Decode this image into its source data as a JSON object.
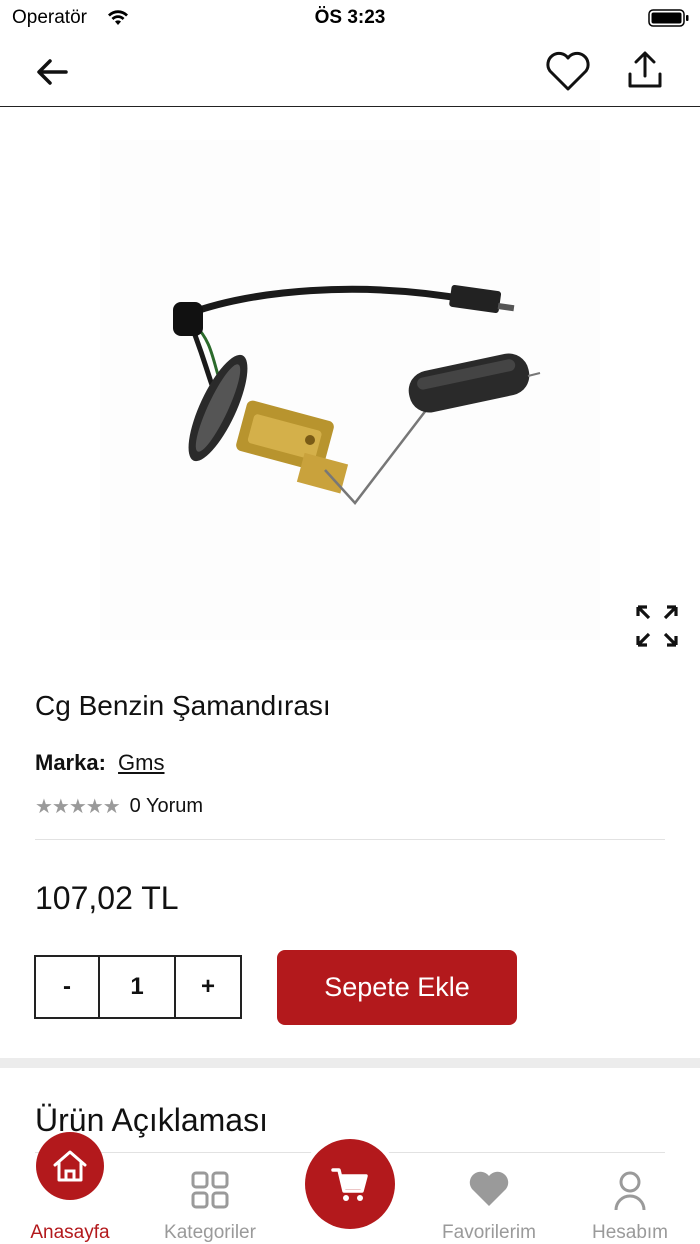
{
  "status_bar": {
    "carrier": "Operatör",
    "time": "ÖS 3:23"
  },
  "nav": {
    "back_icon": "arrow-left-icon",
    "favorite_icon": "heart-outline-icon",
    "share_icon": "share-upload-icon"
  },
  "product": {
    "image_icon": "fuel-float-sensor-photo",
    "title": "Cg Benzin Şamandırası",
    "brand_label": "Marka:",
    "brand_value": "Gms",
    "stars": "★★★★★",
    "rating_value": 0,
    "review_count": "0 Yorum",
    "price": "107,02 TL"
  },
  "quantity": {
    "minus": "-",
    "value": "1",
    "plus": "+"
  },
  "add_to_cart_label": "Sepete Ekle",
  "description_heading": "Ürün Açıklaması",
  "tab_bar": {
    "home": "Anasayfa",
    "categories": "Kategoriler",
    "favorites": "Favorilerim",
    "account": "Hesabım",
    "active": "home"
  },
  "colors": {
    "accent": "#b3191c",
    "inactive": "#9a9a9a",
    "text": "#111111"
  }
}
